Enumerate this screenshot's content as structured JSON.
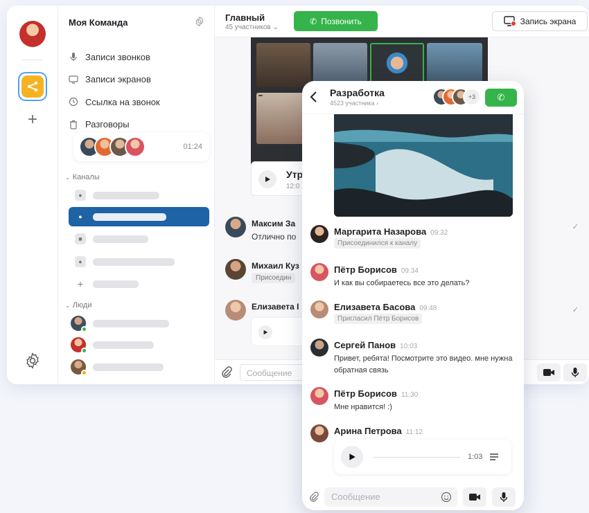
{
  "desktop": {
    "team_name": "Моя Команда",
    "menu": [
      {
        "label": "Записи звонков",
        "icon": "microphone-icon"
      },
      {
        "label": "Записи экранов",
        "icon": "screen-icon"
      },
      {
        "label": "Ссылка на звонок",
        "icon": "clock-icon"
      },
      {
        "label": "Разговоры",
        "icon": "trash-icon"
      }
    ],
    "active_call_time": "01:24",
    "channels_label": "Каналы",
    "people_label": "Люди",
    "chat": {
      "title": "Главный",
      "subtitle": "45 участников",
      "call_button": "Позвонить",
      "record_button": "Запись экрана",
      "audio_title": "Утр",
      "audio_time": "12:0",
      "messages": [
        {
          "name": "Максим За",
          "text": "Отлично по"
        },
        {
          "name": "Михаил Куз",
          "chip": "Присоедин"
        },
        {
          "name": "Елизавета I"
        }
      ],
      "composer_placeholder": "Сообщение"
    }
  },
  "mobile": {
    "title": "Разработка",
    "subtitle": "4523 участника",
    "more_count": "+3",
    "messages": [
      {
        "name": "Маргарита Назарова",
        "time": "09:32",
        "chip": "Присоединился к каналу"
      },
      {
        "name": "Пётр Борисов",
        "time": "09:34",
        "text": "И как вы собираетесь все это делать?"
      },
      {
        "name": "Елизавета Басова",
        "time": "09:48",
        "chip": "Пригласил Пётр Борисов"
      },
      {
        "name": "Сергей Панов",
        "time": "10:03",
        "text": "Привет, ребята! Посмотрите это видео. мне нужна обратная связь"
      },
      {
        "name": "Пётр Борисов",
        "time": "11:30",
        "text": "Мне нравится! :)"
      },
      {
        "name": "Арина Петрова",
        "time": "11:12"
      }
    ],
    "audio_duration": "1:03",
    "composer_placeholder": "Сообщение"
  },
  "colors": {
    "accent_green": "#34b44a",
    "active_channel": "#1d63a6",
    "workspace_yellow": "#f5b324"
  }
}
